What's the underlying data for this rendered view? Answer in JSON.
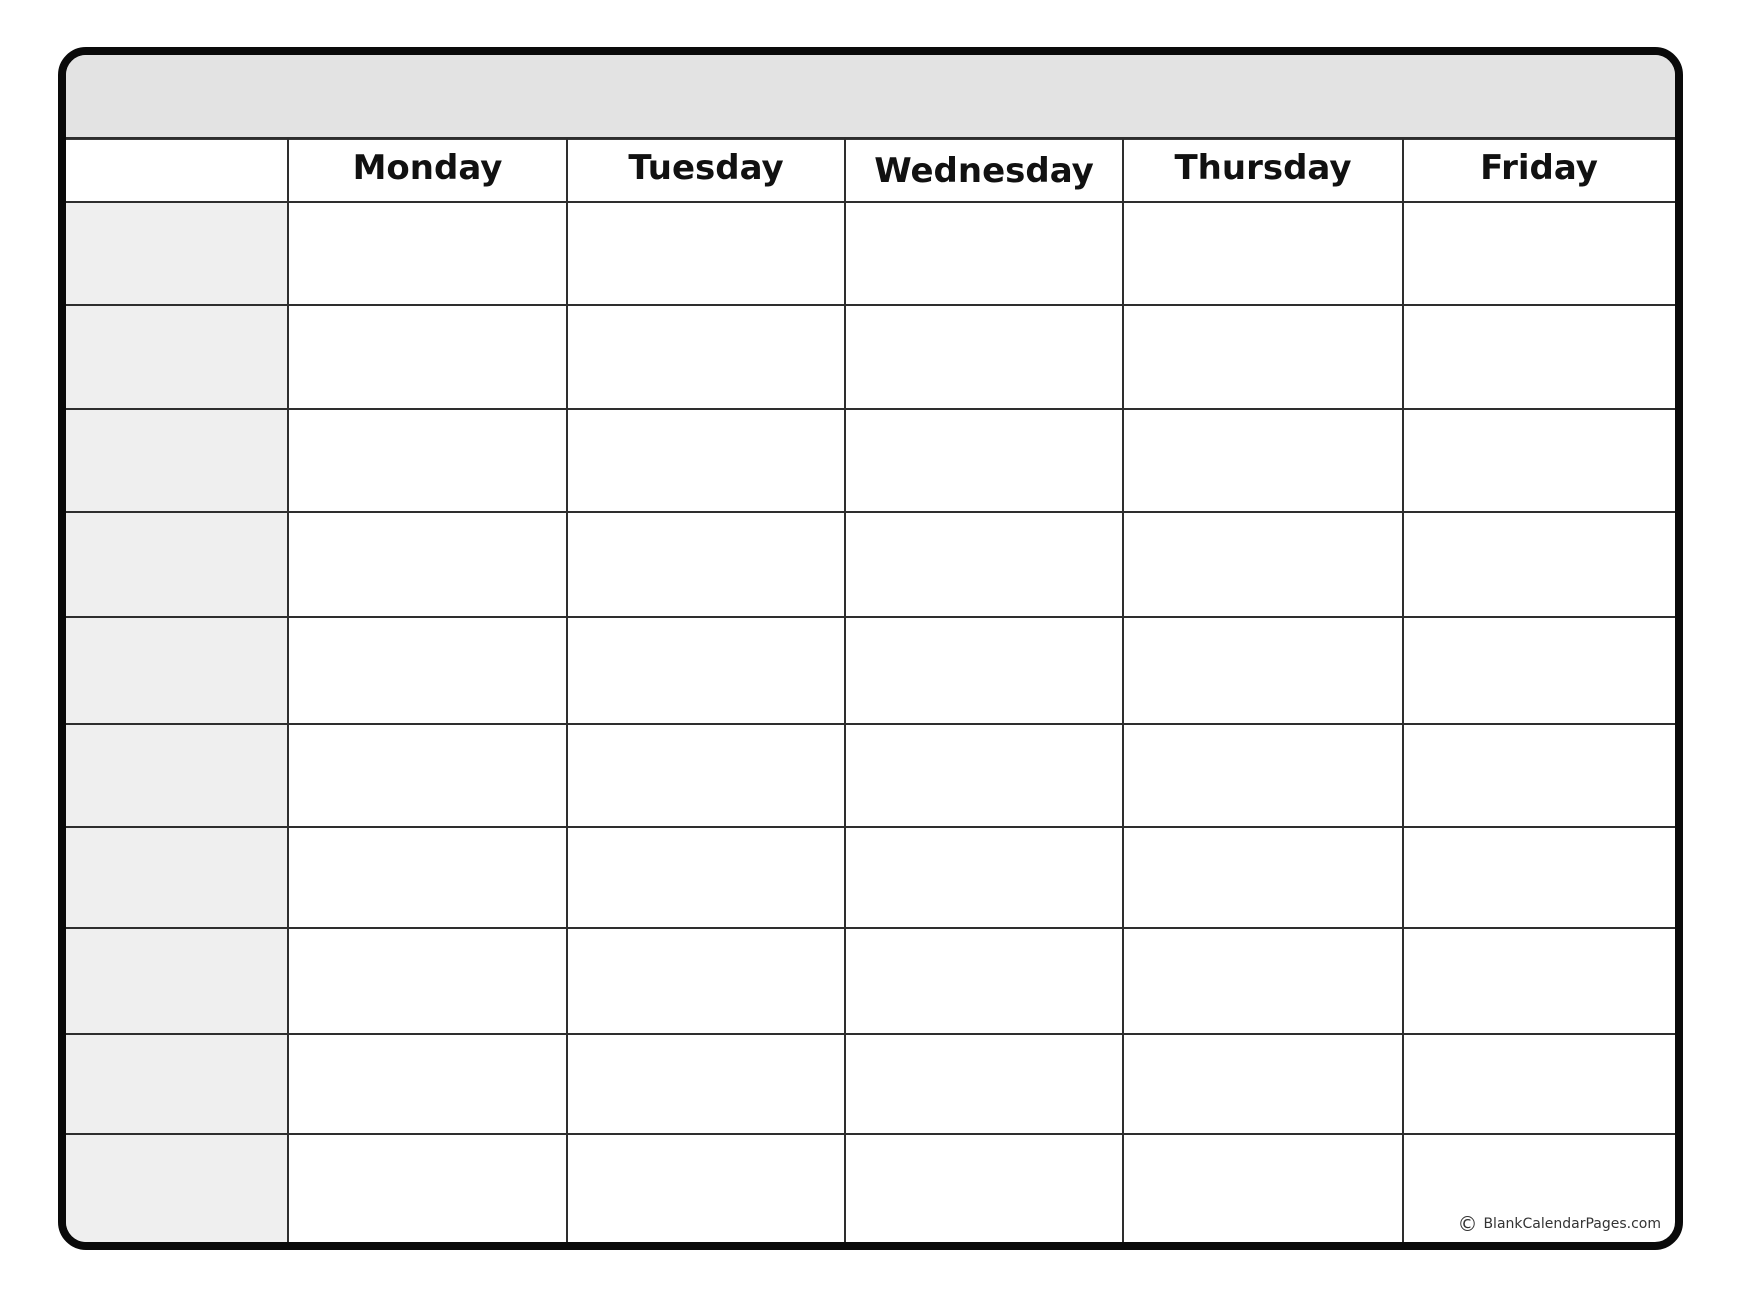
{
  "calendar": {
    "type": "weekly-schedule",
    "title": "",
    "days": [
      {
        "label": "Monday"
      },
      {
        "label": "Tuesday"
      },
      {
        "label": "Wednesday"
      },
      {
        "label": "Thursday"
      },
      {
        "label": "Friday"
      }
    ],
    "time_slot_count": 10,
    "time_slots": [
      "",
      "",
      "",
      "",
      "",
      "",
      "",
      "",
      "",
      ""
    ],
    "copyright": {
      "icon": "copyright-icon",
      "symbol": "©",
      "text": "BlankCalendarPages.com"
    },
    "colors": {
      "border": "#0a0a0a",
      "title_band": "#e3e3e3",
      "time_column": "#efefef",
      "grid_line": "#2e2e2e",
      "text": "#111111"
    }
  }
}
